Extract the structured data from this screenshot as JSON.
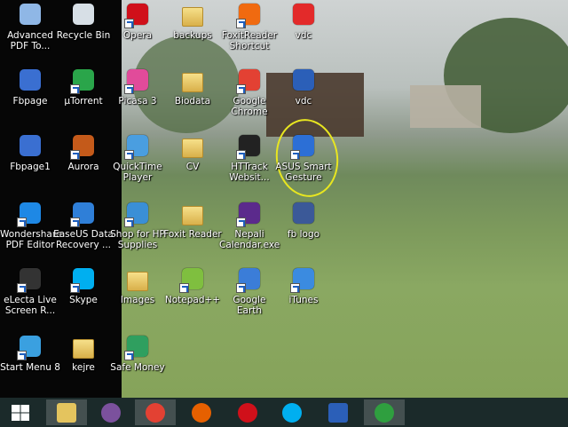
{
  "desktop": {
    "icons": [
      {
        "id": "advanced-pdf",
        "label": "Advanced PDF To...",
        "color": "#8fb7e6",
        "shortcut": false
      },
      {
        "id": "recycle-bin",
        "label": "Recycle Bin",
        "color": "#d7dfe6",
        "shortcut": false
      },
      {
        "id": "opera",
        "label": "Opera",
        "color": "#d0101a",
        "shortcut": true
      },
      {
        "id": "backups",
        "label": "backups",
        "color": "#e4c45e",
        "shortcut": false
      },
      {
        "id": "foxitreader-shortcut",
        "label": "FoxitReader Shortcut",
        "color": "#f06a10",
        "shortcut": true
      },
      {
        "id": "vdc-pdf",
        "label": "vdc",
        "color": "#e32a2a",
        "shortcut": false
      },
      {
        "id": "fbpage",
        "label": "Fbpage",
        "color": "#3a6fd1",
        "shortcut": false
      },
      {
        "id": "utorrent",
        "label": "µTorrent",
        "color": "#2aa54a",
        "shortcut": true
      },
      {
        "id": "picasa3",
        "label": "Picasa 3",
        "color": "#e14b9a",
        "shortcut": true
      },
      {
        "id": "biodata",
        "label": "Biodata",
        "color": "#e4c45e",
        "shortcut": false
      },
      {
        "id": "google-chrome",
        "label": "Google Chrome",
        "color": "#e34133",
        "shortcut": true
      },
      {
        "id": "vdc-doc",
        "label": "vdc",
        "color": "#2b5fb8",
        "shortcut": false
      },
      {
        "id": "fbpage1",
        "label": "Fbpage1",
        "color": "#3a6fd1",
        "shortcut": false
      },
      {
        "id": "aurora",
        "label": "Aurora",
        "color": "#c45a1a",
        "shortcut": true
      },
      {
        "id": "quicktime",
        "label": "QuickTime Player",
        "color": "#4a9ee0",
        "shortcut": true
      },
      {
        "id": "cv",
        "label": "CV",
        "color": "#e4c45e",
        "shortcut": false
      },
      {
        "id": "httrack",
        "label": "HTTrack Websit...",
        "color": "#222222",
        "shortcut": true
      },
      {
        "id": "asus-smart-gesture",
        "label": "ASUS Smart Gesture",
        "color": "#2c6fd6",
        "shortcut": true
      },
      {
        "id": "wondershare",
        "label": "Wondershare PDF Editor",
        "color": "#1e88e5",
        "shortcut": true
      },
      {
        "id": "easeus",
        "label": "EaseUS Data Recovery ...",
        "color": "#2f7fd8",
        "shortcut": true
      },
      {
        "id": "shop-hp",
        "label": "Shop for HP Supplies",
        "color": "#3a8fd6",
        "shortcut": true
      },
      {
        "id": "foxit-reader",
        "label": "Foxit Reader",
        "color": "#e4c45e",
        "shortcut": false
      },
      {
        "id": "nepali-calendar",
        "label": "Nepali Calendar.exe",
        "color": "#5b2a8c",
        "shortcut": true
      },
      {
        "id": "fb-logo",
        "label": "fb logo",
        "color": "#3b5998",
        "shortcut": false
      },
      {
        "id": "electa",
        "label": "eLecta Live Screen R...",
        "color": "#333333",
        "shortcut": true
      },
      {
        "id": "skype",
        "label": "Skype",
        "color": "#00aff0",
        "shortcut": true
      },
      {
        "id": "images",
        "label": "Images",
        "color": "#e4c45e",
        "shortcut": false
      },
      {
        "id": "notepadpp",
        "label": "Notepad++",
        "color": "#7fbf3f",
        "shortcut": true
      },
      {
        "id": "google-earth",
        "label": "Google Earth",
        "color": "#3b7dd8",
        "shortcut": true
      },
      {
        "id": "itunes",
        "label": "iTunes",
        "color": "#3b8be0",
        "shortcut": true
      },
      {
        "id": "start-menu-8",
        "label": "Start Menu 8",
        "color": "#3aa0e0",
        "shortcut": true
      },
      {
        "id": "kejre",
        "label": "kejre",
        "color": "#e4c45e",
        "shortcut": false
      },
      {
        "id": "safe-money",
        "label": "Safe Money",
        "color": "#2f9f5f",
        "shortcut": true
      }
    ]
  },
  "taskbar": {
    "bg": "#1b2a2a",
    "buttons": [
      {
        "id": "start",
        "icon": "windows-logo-icon",
        "color": "#ffffff",
        "active": false
      },
      {
        "id": "file-explorer",
        "icon": "folder-icon",
        "color": "#e4c45e",
        "active": true
      },
      {
        "id": "viber",
        "icon": "viber-icon",
        "color": "#7b519d",
        "active": false
      },
      {
        "id": "chrome",
        "icon": "chrome-icon",
        "color": "#e34133",
        "active": true
      },
      {
        "id": "firefox",
        "icon": "firefox-icon",
        "color": "#e66000",
        "active": false
      },
      {
        "id": "opera",
        "icon": "opera-icon",
        "color": "#d0101a",
        "active": false
      },
      {
        "id": "skype",
        "icon": "skype-icon",
        "color": "#00aff0",
        "active": false
      },
      {
        "id": "word",
        "icon": "word-icon",
        "color": "#2b5fb8",
        "active": false
      },
      {
        "id": "idm",
        "icon": "download-manager-icon",
        "color": "#2f9f3f",
        "active": true
      }
    ]
  }
}
